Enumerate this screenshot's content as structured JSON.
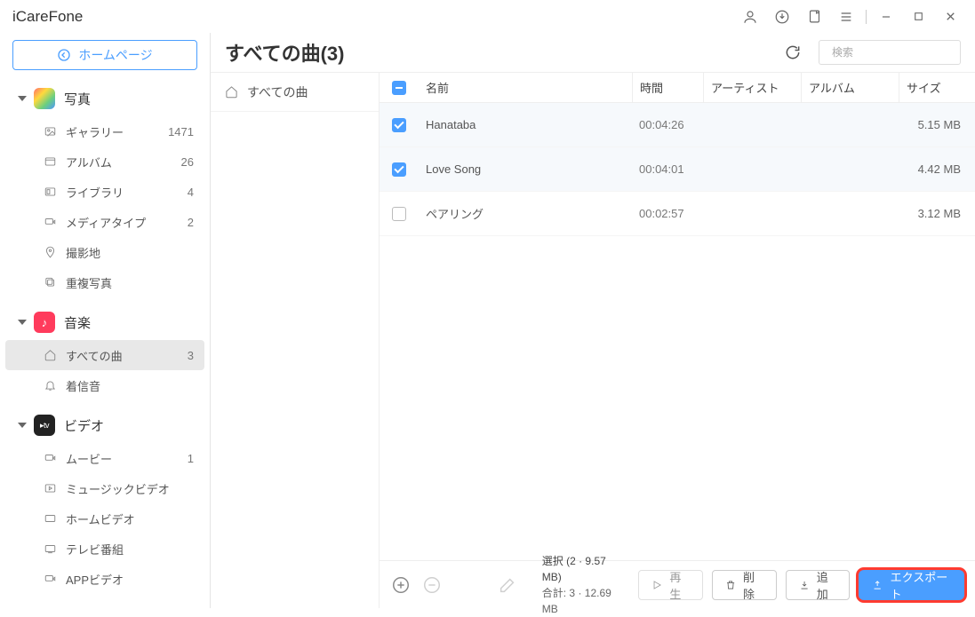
{
  "app_title": "iCareFone",
  "home_button": "ホームページ",
  "search_placeholder": "検索",
  "sidebar": {
    "groups": [
      {
        "label": "写真",
        "icon": "photos",
        "items": [
          {
            "label": "ギャラリー",
            "count": "1471",
            "icon": "image"
          },
          {
            "label": "アルバム",
            "count": "26",
            "icon": "album"
          },
          {
            "label": "ライブラリ",
            "count": "4",
            "icon": "library"
          },
          {
            "label": "メディアタイプ",
            "count": "2",
            "icon": "media"
          },
          {
            "label": "撮影地",
            "count": "",
            "icon": "location"
          },
          {
            "label": "重複写真",
            "count": "",
            "icon": "duplicate"
          }
        ]
      },
      {
        "label": "音楽",
        "icon": "music",
        "items": [
          {
            "label": "すべての曲",
            "count": "3",
            "icon": "home",
            "active": true
          },
          {
            "label": "着信音",
            "count": "",
            "icon": "bell"
          }
        ]
      },
      {
        "label": "ビデオ",
        "icon": "video",
        "items": [
          {
            "label": "ムービー",
            "count": "1",
            "icon": "camera"
          },
          {
            "label": "ミュージックビデオ",
            "count": "",
            "icon": "mv"
          },
          {
            "label": "ホームビデオ",
            "count": "",
            "icon": "home-video"
          },
          {
            "label": "テレビ番組",
            "count": "",
            "icon": "tv"
          },
          {
            "label": "APPビデオ",
            "count": "",
            "icon": "app-video"
          }
        ]
      }
    ]
  },
  "page_title": "すべての曲(3)",
  "left_pane_item": "すべての曲",
  "columns": {
    "name": "名前",
    "time": "時間",
    "artist": "アーティスト",
    "album": "アルバム",
    "size": "サイズ"
  },
  "songs": [
    {
      "name": "Hanataba",
      "time": "00:04:26",
      "artist": "",
      "album": "",
      "size": "5.15 MB",
      "checked": true
    },
    {
      "name": "Love Song",
      "time": "00:04:01",
      "artist": "",
      "album": "",
      "size": "4.42 MB",
      "checked": true
    },
    {
      "name": "ペアリング",
      "time": "00:02:57",
      "artist": "",
      "album": "",
      "size": "3.12 MB",
      "checked": false
    }
  ],
  "footer": {
    "selection": "選択 (2 · 9.57 MB)",
    "total": "合計: 3 · 12.69 MB",
    "play": "再生",
    "delete": "削除",
    "add": "追加",
    "export": "エクスポート"
  }
}
